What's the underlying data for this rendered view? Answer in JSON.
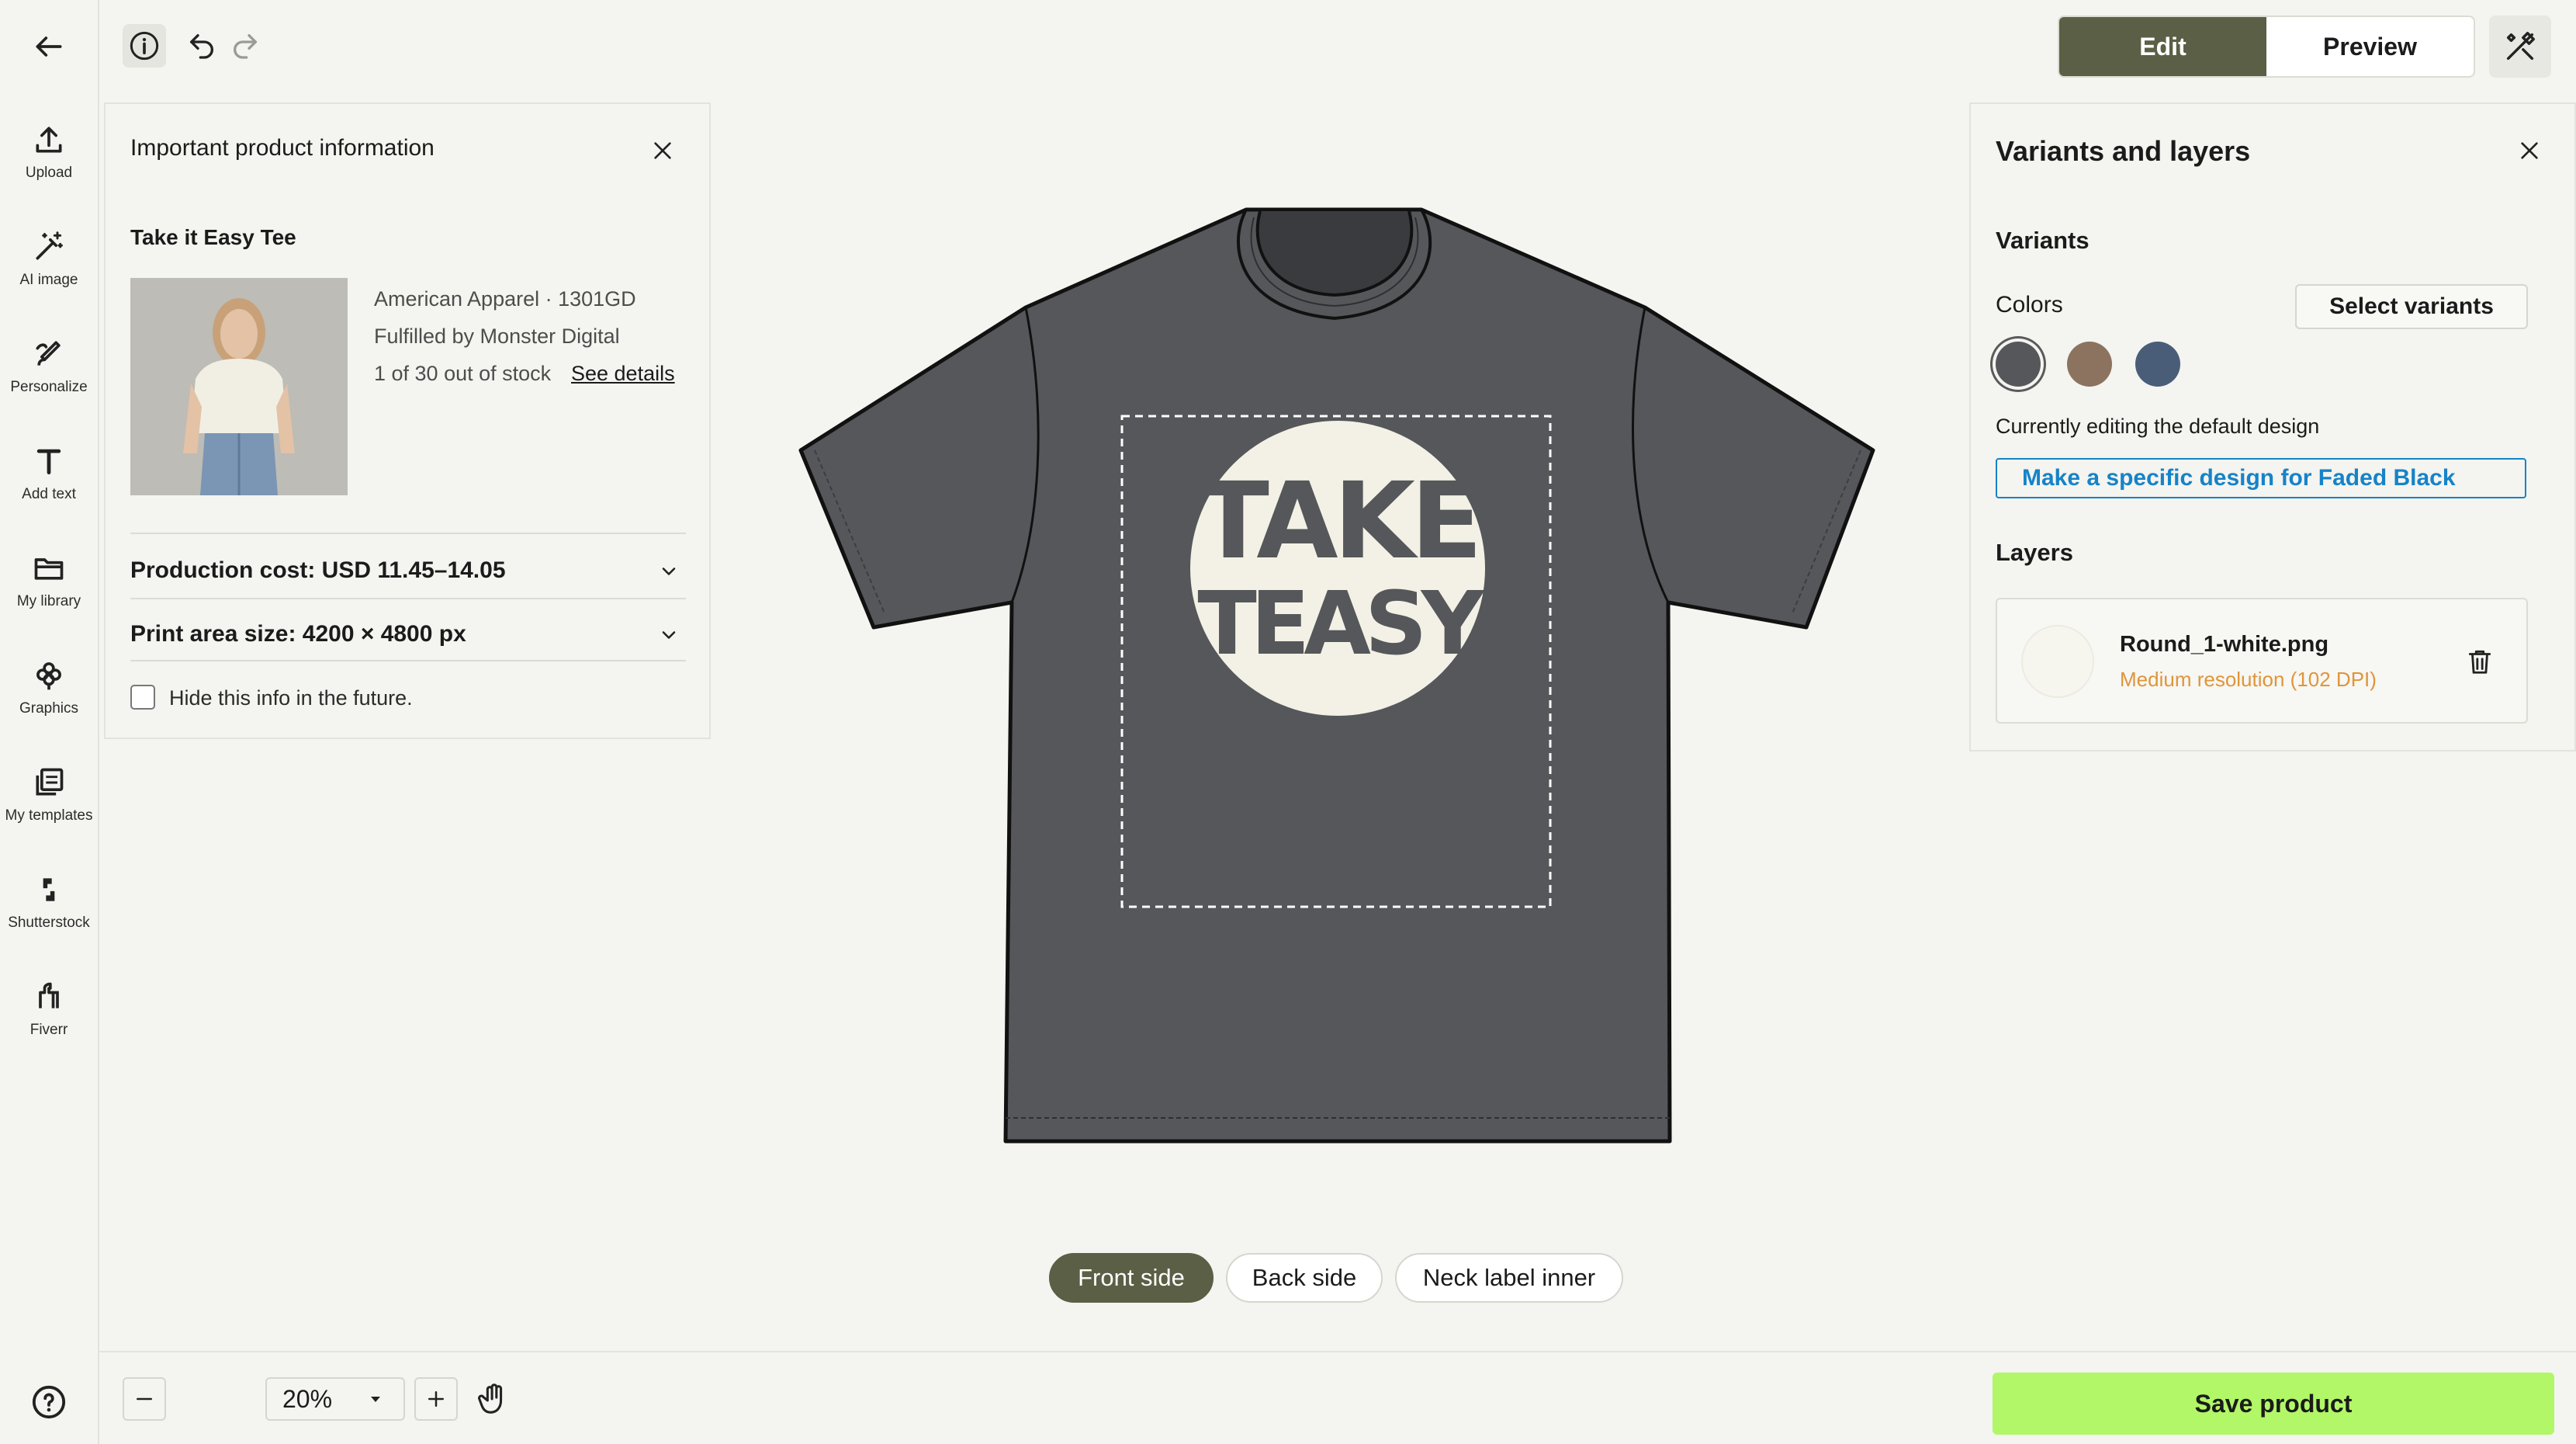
{
  "rail": {
    "items": [
      {
        "label": "Upload",
        "icon": "upload-icon"
      },
      {
        "label": "AI image",
        "icon": "magic-wand-icon"
      },
      {
        "label": "Personalize",
        "icon": "personalize-icon"
      },
      {
        "label": "Add text",
        "icon": "text-icon"
      },
      {
        "label": "My library",
        "icon": "folder-icon"
      },
      {
        "label": "Graphics",
        "icon": "flower-icon"
      },
      {
        "label": "My templates",
        "icon": "templates-icon"
      },
      {
        "label": "Shutterstock",
        "icon": "shutterstock-icon"
      },
      {
        "label": "Fiverr",
        "icon": "fiverr-icon"
      }
    ]
  },
  "topbar": {
    "edit_label": "Edit",
    "preview_label": "Preview"
  },
  "info_panel": {
    "title": "Important product information",
    "product_name": "Take it Easy Tee",
    "brand_line": "American Apparel · 1301GD",
    "fulfilled_line": "Fulfilled by Monster Digital",
    "stock_line": "1 of 30 out of stock",
    "see_details": "See details",
    "production_cost": "Production cost: USD 11.45–14.05",
    "print_area": "Print area size: 4200 × 4800 px",
    "hide_label": "Hide this info in the future."
  },
  "canvas": {
    "artwork_text_top": "TAKE",
    "artwork_text_bottom": "TEASY",
    "shirt_color": "#55575a",
    "sides": [
      "Front side",
      "Back side",
      "Neck label inner"
    ],
    "active_side": "Front side"
  },
  "variants_panel": {
    "title": "Variants and layers",
    "variants_heading": "Variants",
    "colors_label": "Colors",
    "select_variants": "Select variants",
    "swatches": [
      "#55575a",
      "#8c735f",
      "#4a5d78"
    ],
    "editing_note": "Currently editing the default design",
    "make_specific": "Make a specific design for Faded Black",
    "layers_heading": "Layers",
    "layer_name": "Round_1-white.png",
    "layer_resolution": "Medium resolution (102 DPI)"
  },
  "bottom": {
    "zoom": "20%",
    "save_label": "Save product"
  }
}
